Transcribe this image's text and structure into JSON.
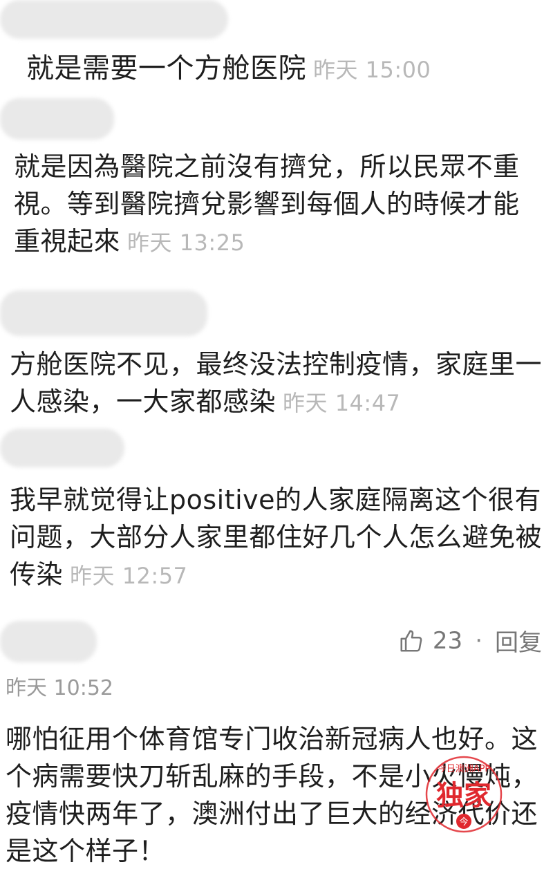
{
  "comments": [
    {
      "text": "就是需要一个方舱医院",
      "time": "昨天 15:00"
    },
    {
      "text": "就是因為醫院之前沒有擠兌，所以民眾不重視。等到醫院擠兌影響到每個人的時候才能重視起來",
      "time": "昨天 13:25"
    },
    {
      "text": "方舱医院不见，最终没法控制疫情，家庭里一人感染，一大家都感染",
      "time": "昨天 14:47"
    },
    {
      "text": "我早就觉得让positive的人家庭隔离这个很有问题，大部分人家里都住好几个人怎么避免被传染",
      "time": "昨天 12:57"
    },
    {
      "text": "哪怕征用个体育馆专门收治新冠病人也好。这个病需要快刀斩乱麻的手段，不是小火慢炖，疫情快两年了，澳洲付出了巨大的经济代价还是这个样子！"
    }
  ],
  "actions": {
    "like_count": "23",
    "separator": "·",
    "reply_label": "回复"
  },
  "standalone_time": "昨天 10:52",
  "watermark": {
    "small_text": "今日澳洲APP",
    "large_text": "独家",
    "bottom_char": "今",
    "color": "#e0282e"
  },
  "icons": {
    "like": "thumbs-up-icon"
  }
}
